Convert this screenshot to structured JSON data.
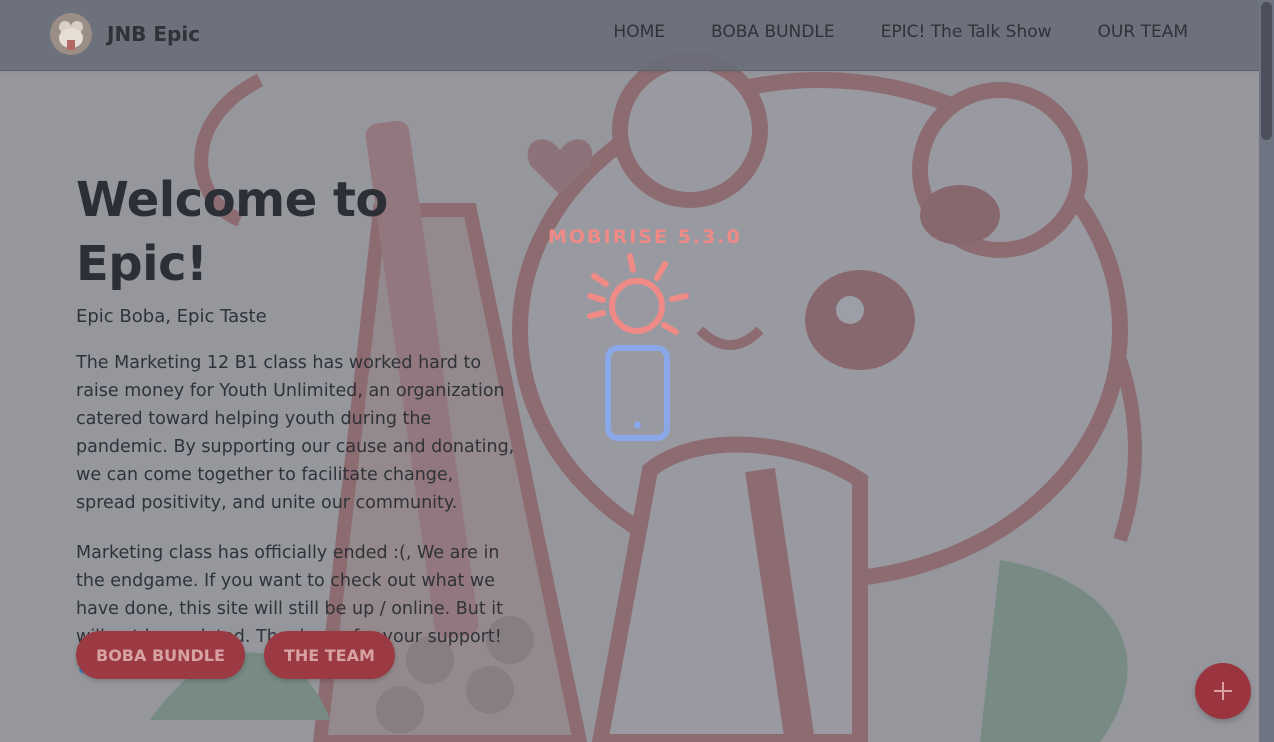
{
  "brand": {
    "name": "JNB Epic",
    "logo": "boba-bear-logo"
  },
  "nav": {
    "items": [
      "HOME",
      "BOBA BUNDLE",
      "EPIC! The Talk Show",
      "OUR TEAM"
    ]
  },
  "hero": {
    "title": "Welcome to Epic!",
    "subtitle": "Epic Boba, Epic Taste",
    "paragraph1": "The Marketing 12 B1 class has worked hard to raise money for Youth Unlimited, an organization catered toward helping youth during the pandemic. By supporting our cause and donating, we can come together to facilitate change, spread positivity, and unite our community.",
    "paragraph2": "Marketing class has officially ended :(, We are in the endgame. If you want to check out what we have done, this site will still be up / online. But it will not be updated. Thank you for your support! 🙏",
    "buttons": [
      "BOBA BUNDLE",
      "THE TEAM"
    ]
  },
  "loader": {
    "label": "MOBIRISE  5.3.0",
    "icons": [
      "sun-icon",
      "mobile-phone-icon"
    ]
  },
  "fab": {
    "icon": "plus-icon"
  },
  "colors": {
    "accent": "#9b3a43",
    "loader_sun": "#ef8a86",
    "loader_phone": "#8aa7e8",
    "overlay": "#5f6473"
  }
}
